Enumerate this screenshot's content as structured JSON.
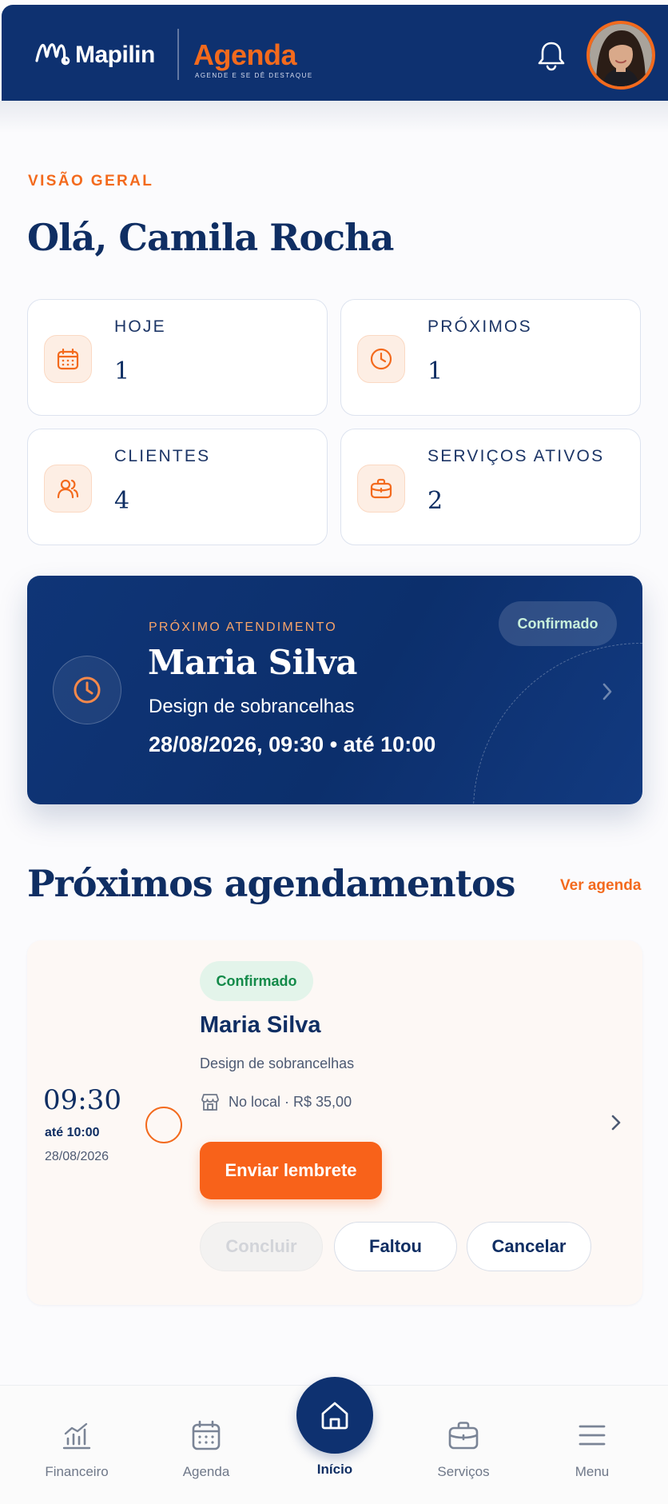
{
  "header": {
    "brand": "Mapilin",
    "title": "Agenda",
    "tagline": "AGENDE E SE DÊ DESTAQUE",
    "icons": [
      "bell-icon",
      "avatar"
    ],
    "colors": {
      "navy": "#0e3170",
      "orange": "#f36a1d"
    }
  },
  "overview": {
    "eyebrow": "VISÃO GERAL",
    "greeting": "Olá, Camila Rocha",
    "stats": [
      {
        "label": "HOJE",
        "value": "1",
        "icon": "calendar-icon"
      },
      {
        "label": "PRÓXIMOS",
        "value": "1",
        "icon": "clock-icon"
      },
      {
        "label": "CLIENTES",
        "value": "4",
        "icon": "users-icon"
      },
      {
        "label": "SERVIÇOS ATIVOS",
        "value": "2",
        "icon": "briefcase-icon"
      }
    ]
  },
  "next_appointment": {
    "eyebrow": "PRÓXIMO ATENDIMENTO",
    "client": "Maria Silva",
    "service": "Design de sobrancelhas",
    "datetime": "28/08/2026, 09:30 • até 10:00",
    "status": "Confirmado"
  },
  "upcoming": {
    "title": "Próximos agendamentos",
    "see_all": "Ver agenda",
    "items": [
      {
        "time": "09:30",
        "until": "até 10:00",
        "date": "28/08/2026",
        "status": "Confirmado",
        "client": "Maria Silva",
        "service": "Design de sobrancelhas",
        "meta": "No local · R$ 35,00",
        "reminder_button": "Enviar lembrete",
        "complete_button": "Concluir",
        "no_show_button": "Faltou",
        "cancel_button": "Cancelar"
      }
    ]
  },
  "bottom_nav": {
    "items": [
      {
        "label": "Financeiro",
        "icon": "chart-icon"
      },
      {
        "label": "Agenda",
        "icon": "calendar-icon"
      },
      {
        "label": "Início",
        "icon": "home-icon",
        "active": true
      },
      {
        "label": "Serviços",
        "icon": "briefcase-icon"
      },
      {
        "label": "Menu",
        "icon": "menu-icon"
      }
    ]
  }
}
